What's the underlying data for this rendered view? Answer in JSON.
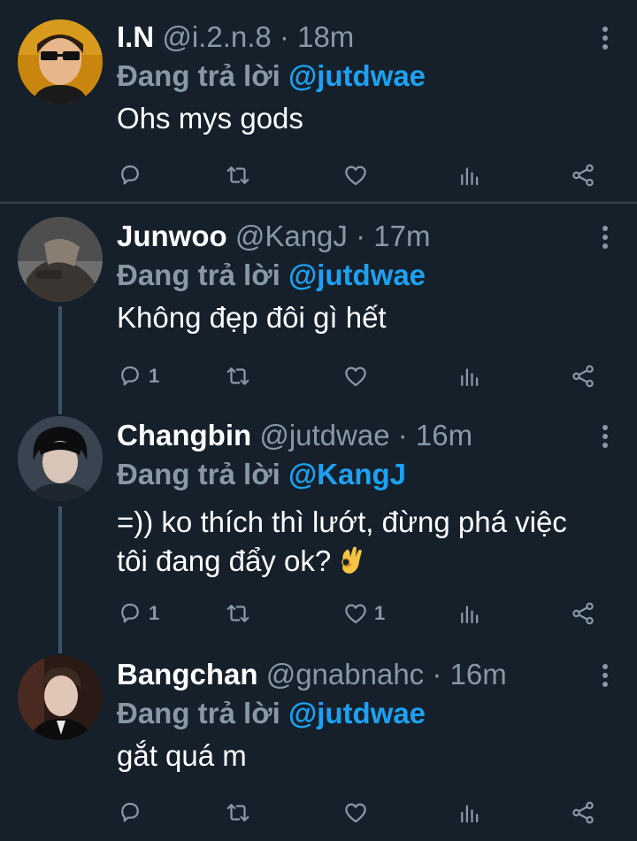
{
  "reply_prefix": "Đang trả lời",
  "colors": {
    "background": "#15202b",
    "text_primary": "#ffffff",
    "text_secondary": "#8899a6",
    "link": "#1da1f2",
    "divider": "#38444d"
  },
  "tweets": [
    {
      "name": "I.N",
      "handle": "@i.2.n.8",
      "separator": "·",
      "time": "18m",
      "reply_to": "@jutdwae",
      "text": "Ohs mys gods",
      "reply_count": "",
      "retweet_count": "",
      "like_count": "",
      "avatar_icon": "avatar-photo"
    },
    {
      "name": "Junwoo",
      "handle": "@KangJ",
      "separator": "·",
      "time": "17m",
      "reply_to": "@jutdwae",
      "text": "Không đẹp đôi gì hết",
      "reply_count": "1",
      "retweet_count": "",
      "like_count": "",
      "avatar_icon": "avatar-photo"
    },
    {
      "name": "Changbin",
      "handle": "@jutdwae",
      "separator": "·",
      "time": "16m",
      "reply_to": "@KangJ",
      "text_line1": "=)) ko thích thì lướt, đừng phá việc",
      "text_line2": "tôi đang đẩy ok?",
      "emoji_icon": "ok-hand-emoji",
      "reply_count": "1",
      "retweet_count": "",
      "like_count": "1",
      "avatar_icon": "avatar-photo"
    },
    {
      "name": "Bangchan",
      "handle": "@gnabnahc",
      "separator": "·",
      "time": "16m",
      "reply_to": "@jutdwae",
      "text": "gắt quá m",
      "reply_count": "",
      "retweet_count": "",
      "like_count": "",
      "avatar_icon": "avatar-photo"
    }
  ],
  "action_icons": [
    "reply-icon",
    "retweet-icon",
    "like-icon",
    "analytics-icon",
    "share-icon"
  ]
}
